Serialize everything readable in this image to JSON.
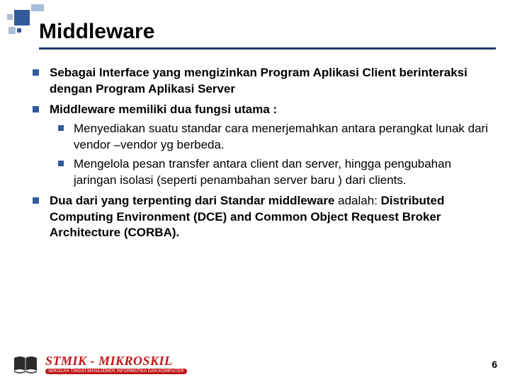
{
  "title": "Middleware",
  "bullets": {
    "b1": "Sebagai Interface yang mengizinkan Program Aplikasi Client berinteraksi dengan  Program Aplikasi Server",
    "b2_lead": "Middleware memiliki dua fungsi utama :",
    "b2_sub1": "Menyediakan suatu standar cara menerjemahkan antara perangkat lunak dari vendor –vendor  yg berbeda.",
    "b2_sub2": "Mengelola pesan transfer antara client dan server, hingga pengubahan jaringan  isolasi (seperti penambahan server baru ) dari clients.",
    "b3_bold1": "Dua dari yang terpenting dari Standar middleware",
    "b3_plain": " adalah: ",
    "b3_bold2": "Distributed Computing Environment (DCE) and Common Object Request Broker Architecture (CORBA)."
  },
  "footer": {
    "logo_main": "STMIK - MIKROSKIL",
    "logo_sub": "SEKOLAH TINGGI MANAJEMEN INFORMATIKA DAN KOMPUTER",
    "page_number": "6"
  }
}
